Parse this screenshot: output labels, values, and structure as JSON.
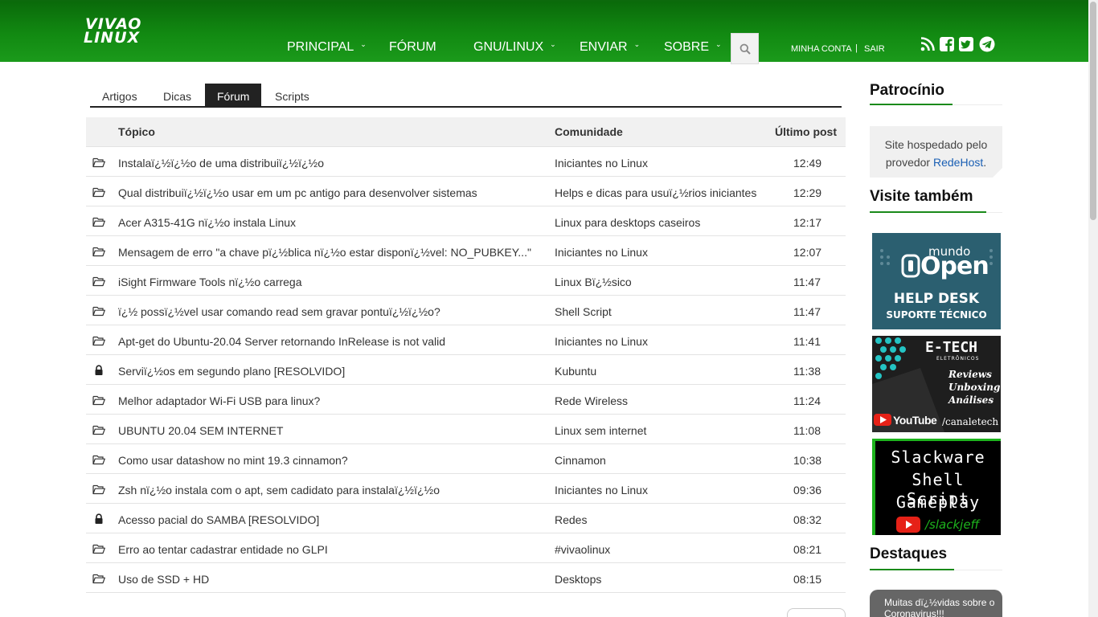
{
  "logo": {
    "line1": "VIVAO",
    "line2": "LINUX"
  },
  "nav": {
    "items": [
      {
        "label": "PRINCIPAL",
        "has_dropdown": true
      },
      {
        "label": "FÓRUM",
        "has_dropdown": false
      },
      {
        "label": "GNU/LINUX",
        "has_dropdown": true
      },
      {
        "label": "ENVIAR",
        "has_dropdown": true
      },
      {
        "label": "SOBRE",
        "has_dropdown": true
      }
    ],
    "chevron": "⌄",
    "search_icon": "search-icon",
    "account": {
      "my_account": "MINHA CONTA",
      "separator": "|",
      "logout": "SAIR"
    },
    "social_icons": [
      "rss-icon",
      "facebook-icon",
      "twitter-icon",
      "telegram-icon"
    ]
  },
  "tabs": [
    {
      "label": "Artigos",
      "active": false
    },
    {
      "label": "Dicas",
      "active": false
    },
    {
      "label": "Fórum",
      "active": true
    },
    {
      "label": "Scripts",
      "active": false
    }
  ],
  "table": {
    "headers": {
      "topic": "Tópico",
      "community": "Comunidade",
      "last_post": "Último post"
    },
    "rows": [
      {
        "icon": "folder-open-icon",
        "topic": "Instalaï¿½ï¿½o de uma distribuiï¿½ï¿½o",
        "community": "Iniciantes no Linux",
        "time": "12:49"
      },
      {
        "icon": "folder-open-icon",
        "topic": "Qual distribuiï¿½ï¿½o usar em um pc antigo para desenvolver sistemas",
        "community": "Helps e dicas para usuï¿½rios iniciantes",
        "time": "12:29"
      },
      {
        "icon": "folder-open-icon",
        "topic": "Acer A315-41G nï¿½o instala Linux",
        "community": "Linux para desktops caseiros",
        "time": "12:17"
      },
      {
        "icon": "folder-open-icon",
        "topic": "Mensagem de erro \"a chave pï¿½blica nï¿½o estar disponï¿½vel: NO_PUBKEY...\"",
        "community": "Iniciantes no Linux",
        "time": "12:07"
      },
      {
        "icon": "folder-open-icon",
        "topic": "iSight Firmware Tools nï¿½o carrega",
        "community": "Linux Bï¿½sico",
        "time": "11:47"
      },
      {
        "icon": "folder-open-icon",
        "topic": "ï¿½ possï¿½vel usar comando read sem gravar pontuï¿½ï¿½o?",
        "community": "Shell Script",
        "time": "11:47"
      },
      {
        "icon": "folder-open-icon",
        "topic": "Apt-get do Ubuntu-20.04 Server retornando InRelease is not valid",
        "community": "Iniciantes no Linux",
        "time": "11:41"
      },
      {
        "icon": "lock-icon",
        "topic": "Serviï¿½os em segundo plano [RESOLVIDO]",
        "community": "Kubuntu",
        "time": "11:38"
      },
      {
        "icon": "folder-open-icon",
        "topic": "Melhor adaptador Wi-Fi USB para linux?",
        "community": "Rede Wireless",
        "time": "11:24"
      },
      {
        "icon": "folder-open-icon",
        "topic": "UBUNTU 20.04 SEM INTERNET",
        "community": "Linux sem internet",
        "time": "11:08"
      },
      {
        "icon": "folder-open-icon",
        "topic": "Como usar datashow no mint 19.3 cinnamon?",
        "community": "Cinnamon",
        "time": "10:38"
      },
      {
        "icon": "folder-open-icon",
        "topic": "Zsh nï¿½o instala com o apt, sem cadidato para instalaï¿½ï¿½o",
        "community": "Iniciantes no Linux",
        "time": "09:36"
      },
      {
        "icon": "lock-icon",
        "topic": "Acesso pacial do SAMBA [RESOLVIDO]",
        "community": "Redes",
        "time": "08:32"
      },
      {
        "icon": "folder-open-icon",
        "topic": "Erro ao tentar cadastrar entidade no GLPI",
        "community": "#vivaolinux",
        "time": "08:21"
      },
      {
        "icon": "folder-open-icon",
        "topic": "Uso de SSD + HD",
        "community": "Desktops",
        "time": "08:15"
      }
    ]
  },
  "sidebar": {
    "sponsor_title": "Patrocínio",
    "sponsor_text": "Site hospedado pelo provedor ",
    "sponsor_link": "RedeHost",
    "sponsor_end": ".",
    "visit_title": "Visite também",
    "banners": [
      {
        "line1": "mundo",
        "line2": "Open",
        "line3": "HELP DESK",
        "line4": "SUPORTE TÉCNICO"
      },
      {
        "line1": "E-TECH",
        "line2": "ELETRÔNICOS",
        "line3": "Reviews",
        "line4": "Unboxing",
        "line5": "Análises",
        "line6": "YouTube",
        "line7": "/canaletech"
      },
      {
        "line1": "Slackware",
        "line2": "Shell Script",
        "line3": "Gameplay",
        "line4": "/slackjeff"
      }
    ],
    "highlights_title": "Destaques",
    "highlight_text": "Muitas dï¿½vidas sobre o Coronavirus!!!"
  },
  "colors": {
    "header_green": "#128a12",
    "accent_green": "#1a8a1a",
    "link_blue": "#1a5fb4",
    "tab_active": "#222222"
  }
}
